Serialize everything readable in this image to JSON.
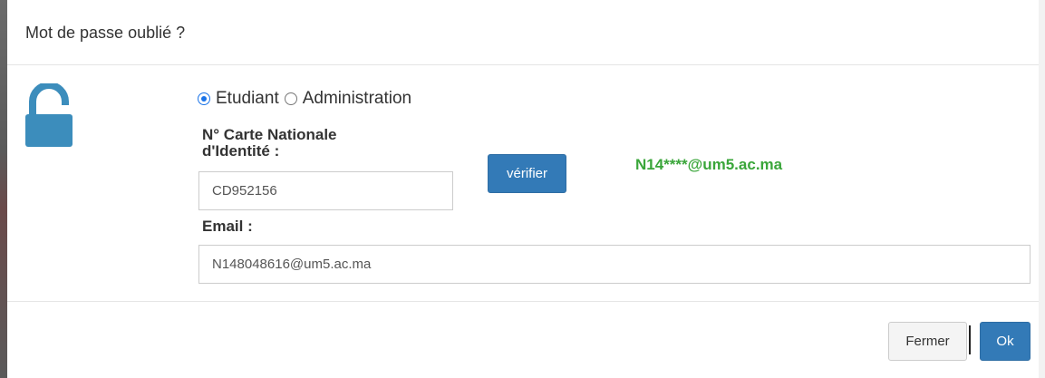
{
  "dialog": {
    "title": "Mot de passe oublié ?"
  },
  "user_type": {
    "options": [
      {
        "label": "Etudiant",
        "selected": true
      },
      {
        "label": "Administration",
        "selected": false
      }
    ]
  },
  "cin": {
    "label": "N° Carte Nationale d'Identité :",
    "value": "CD952156"
  },
  "verify_button": {
    "label": "vérifier"
  },
  "masked_email": "N14****@um5.ac.ma",
  "email": {
    "label": "Email :",
    "value": "N148048616@um5.ac.ma"
  },
  "footer": {
    "close_label": "Fermer",
    "ok_label": "Ok"
  },
  "colors": {
    "primary": "#337ab7",
    "success_text": "#3aa63a",
    "lock_icon": "#3c8dbc"
  },
  "icons": {
    "header_icon": "unlock-icon"
  }
}
